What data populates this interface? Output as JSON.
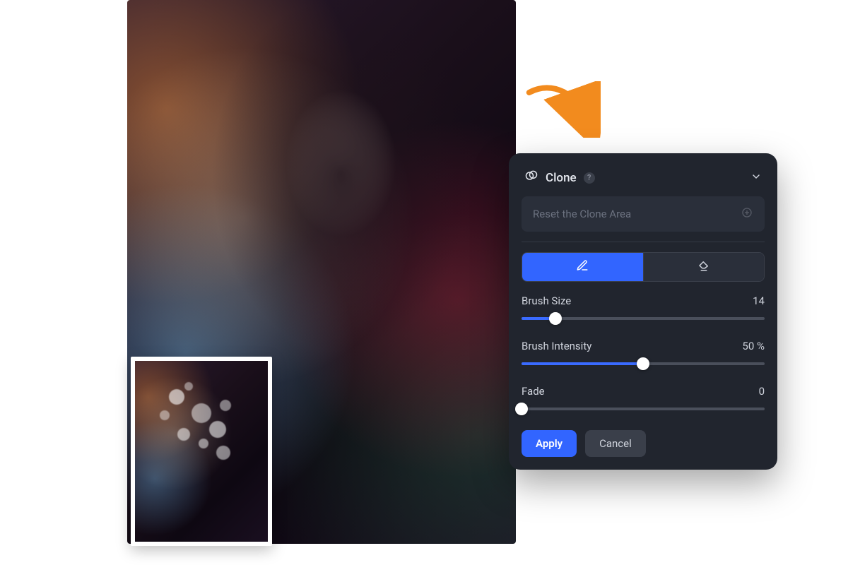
{
  "panel": {
    "title": "Clone",
    "reset_label": "Reset the Clone Area",
    "tools": {
      "draw_icon": "pencil-icon",
      "erase_icon": "eraser-icon",
      "active": "draw"
    },
    "sliders": {
      "brush_size": {
        "label": "Brush Size",
        "value_text": "14",
        "percent": 14
      },
      "brush_intensity": {
        "label": "Brush Intensity",
        "value_text": "50 %",
        "percent": 50
      },
      "fade": {
        "label": "Fade",
        "value_text": "0",
        "percent": 0
      }
    },
    "actions": {
      "apply": "Apply",
      "cancel": "Cancel"
    }
  }
}
